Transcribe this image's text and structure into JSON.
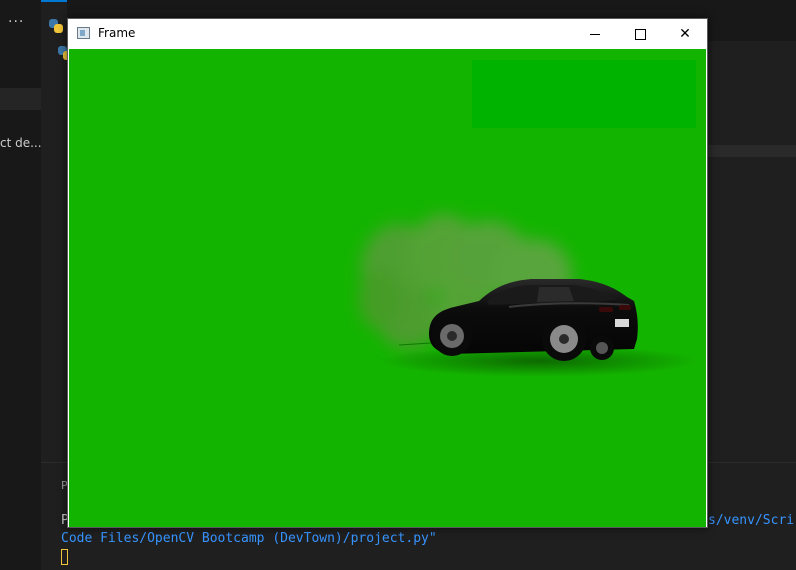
{
  "vscode": {
    "sidebar_text": "ct de...",
    "more_glyph": "···",
    "panel_label": "P",
    "terminal_prefix": "P",
    "terminal_line1_right": "s/venv/Scri",
    "terminal_line2": "Code Files/OpenCV Bootcamp (DevTown)/project.py\""
  },
  "frame": {
    "title": "Frame",
    "icons": {
      "app": "window-app-icon",
      "minimize": "minimize-icon",
      "maximize": "maximize-icon",
      "close": "close-icon"
    },
    "close_glyph": "✕",
    "video": {
      "background": "#13b400",
      "overlay_rect": "#00b300",
      "subject": "black sports car drifting with smoke"
    }
  }
}
